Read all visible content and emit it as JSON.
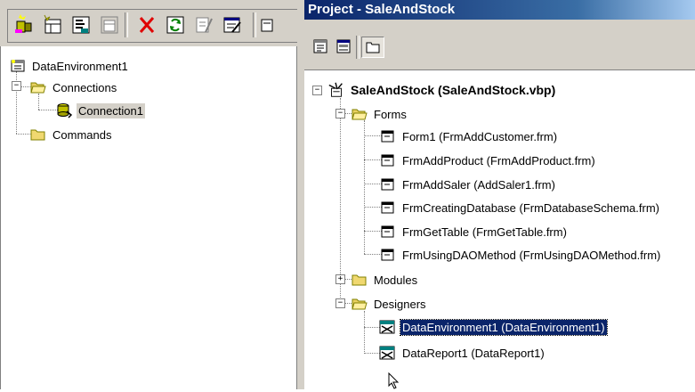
{
  "left_panel": {
    "toolbar_icons": [
      "add-connection-icon",
      "add-command-icon",
      "insert-stored-procedures-icon",
      "add-child-command-icon",
      "delete-icon",
      "refresh-icon",
      "design-icon",
      "properties-icon",
      "options-icon"
    ],
    "tree": {
      "root": "DataEnvironment1",
      "connections": "Connections",
      "connection1": "Connection1",
      "commands": "Commands"
    }
  },
  "right_panel": {
    "title": "Project - SaleAndStock",
    "toolbar_icons": [
      "view-code-icon",
      "view-object-icon",
      "toggle-folders-icon"
    ],
    "tree": {
      "project": "SaleAndStock (SaleAndStock.vbp)",
      "forms": "Forms",
      "form_items": [
        "Form1 (FrmAddCustomer.frm)",
        "FrmAddProduct (FrmAddProduct.frm)",
        "FrmAddSaler (AddSaler1.frm)",
        "FrmCreatingDatabase (FrmDatabaseSchema.frm)",
        "FrmGetTable (FrmGetTable.frm)",
        "FrmUsingDAOMethod (FrmUsingDAOMethod.frm)"
      ],
      "modules": "Modules",
      "designers": "Designers",
      "designer_items": [
        "DataEnvironment1 (DataEnvironment1)",
        "DataReport1 (DataReport1)"
      ]
    }
  },
  "colors": {
    "title_bar": "#0a246a",
    "selection": "#0a246a",
    "face": "#d4d0c8"
  }
}
